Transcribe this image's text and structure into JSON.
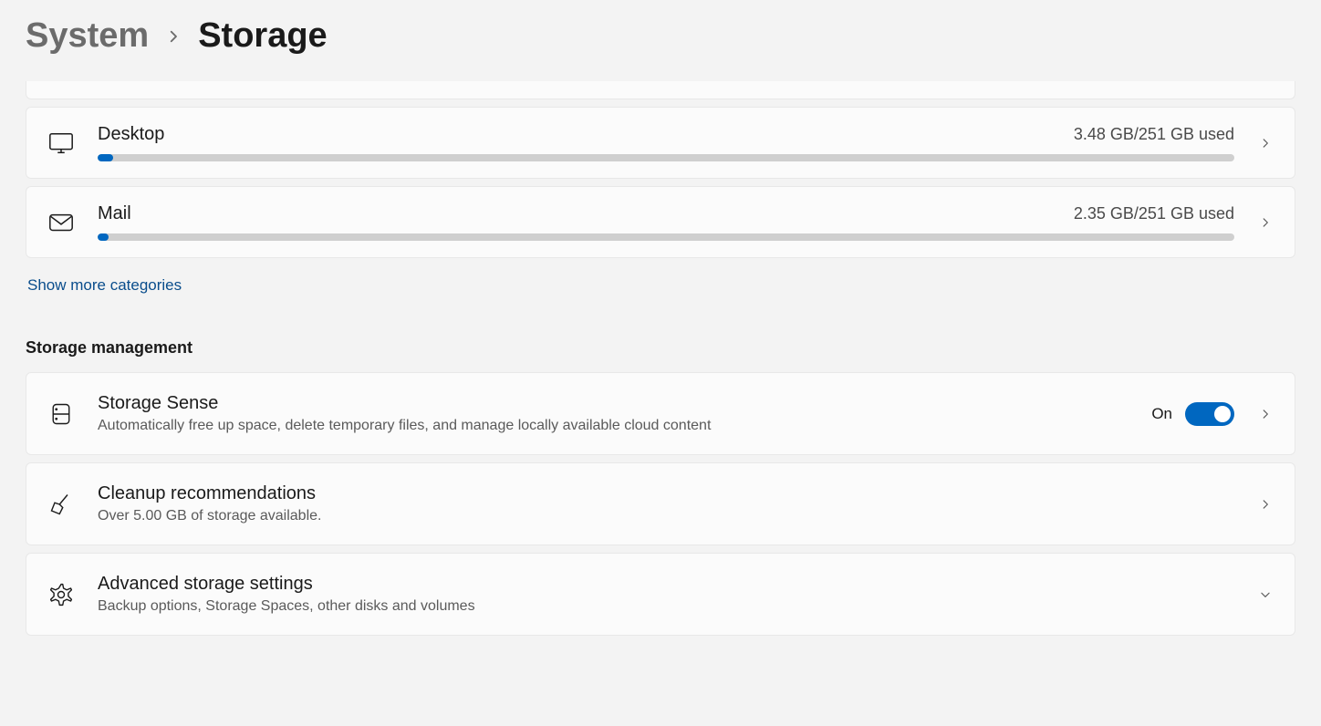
{
  "breadcrumb": {
    "parent": "System",
    "current": "Storage"
  },
  "categories": [
    {
      "key": "desktop",
      "label": "Desktop",
      "usage": "3.48 GB/251 GB used",
      "fill_percent": 1.4
    },
    {
      "key": "mail",
      "label": "Mail",
      "usage": "2.35 GB/251 GB used",
      "fill_percent": 0.95
    }
  ],
  "show_more": "Show more categories",
  "management_header": "Storage management",
  "storage_sense": {
    "title": "Storage Sense",
    "subtitle": "Automatically free up space, delete temporary files, and manage locally available cloud content",
    "state_label": "On",
    "on": true
  },
  "cleanup": {
    "title": "Cleanup recommendations",
    "subtitle": "Over 5.00 GB of storage available."
  },
  "advanced": {
    "title": "Advanced storage settings",
    "subtitle": "Backup options, Storage Spaces, other disks and volumes"
  }
}
